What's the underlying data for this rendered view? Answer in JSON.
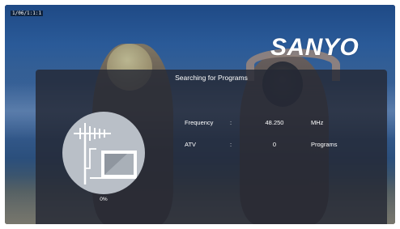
{
  "osd": {
    "corner_label": "1/06/1:1:1",
    "brand": "SANYO"
  },
  "scan": {
    "title": "Searching for Programs",
    "progress_text": "0%",
    "progress": 0.0,
    "rows": [
      {
        "label": "Frequency",
        "separator": ":",
        "value": "48.250",
        "unit": "MHz"
      },
      {
        "label": "ATV",
        "separator": ":",
        "value": "0",
        "unit": "Programs"
      }
    ]
  },
  "colors": {
    "panel": "#242834",
    "progress_accent": "#27b6d6",
    "graphic_bg": "#b9bfc7"
  },
  "icons": {
    "antenna": "antenna-tv-icon"
  }
}
